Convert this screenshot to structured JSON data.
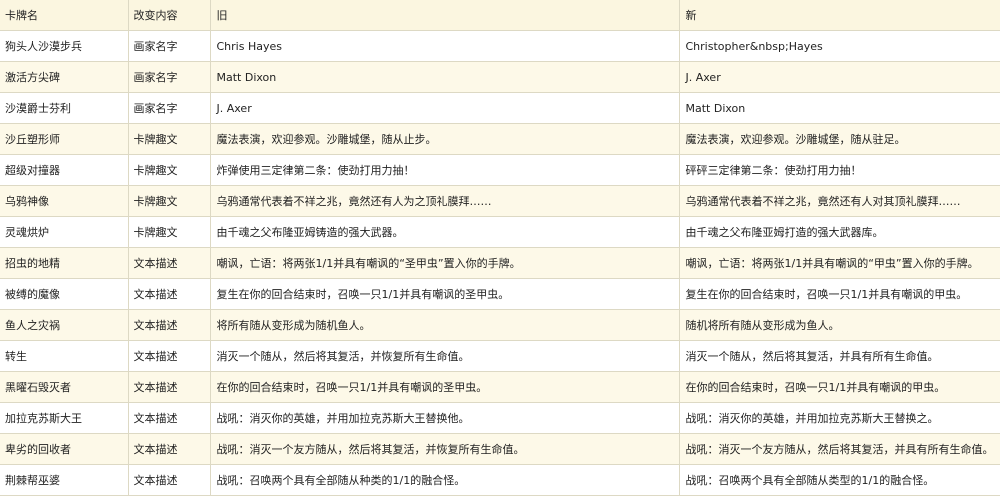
{
  "header": {
    "card_name": "卡牌名",
    "change_type": "改变内容",
    "old": "旧",
    "new": "新"
  },
  "rows": [
    {
      "card_name": "狗头人沙漠步兵",
      "change_type": "画家名字",
      "old": "Chris Hayes",
      "new": "Christopher&nbsp;Hayes"
    },
    {
      "card_name": "激活方尖碑",
      "change_type": "画家名字",
      "old": "Matt Dixon",
      "new": "J. Axer"
    },
    {
      "card_name": "沙漠爵士芬利",
      "change_type": "画家名字",
      "old": "J. Axer",
      "new": "Matt Dixon"
    },
    {
      "card_name": "沙丘塑形师",
      "change_type": "卡牌趣文",
      "old": "魔法表演，欢迎参观。沙雕城堡，随从止步。",
      "new": "魔法表演，欢迎参观。沙雕城堡，随从驻足。"
    },
    {
      "card_name": "超级对撞器",
      "change_type": "卡牌趣文",
      "old": "炸弹使用三定律第二条：使劲打用力抽！",
      "new": "砰砰三定律第二条：使劲打用力抽！"
    },
    {
      "card_name": "乌鸦神像",
      "change_type": "卡牌趣文",
      "old": "乌鸦通常代表着不祥之兆，竟然还有人为之顶礼膜拜……",
      "new": "乌鸦通常代表着不祥之兆，竟然还有人对其顶礼膜拜……"
    },
    {
      "card_name": "灵魂烘炉",
      "change_type": "卡牌趣文",
      "old": "由千魂之父布隆亚姆铸造的强大武器。",
      "new": "由千魂之父布隆亚姆打造的强大武器库。"
    },
    {
      "card_name": "招虫的地精",
      "change_type": "文本描述",
      "old": "嘲讽，亡语：将两张1/1并具有嘲讽的“圣甲虫”置入你的手牌。",
      "new": "嘲讽，亡语：将两张1/1并具有嘲讽的“甲虫”置入你的手牌。"
    },
    {
      "card_name": "被缚的魔像",
      "change_type": "文本描述",
      "old": "复生在你的回合结束时，召唤一只1/1并具有嘲讽的圣甲虫。",
      "new": "复生在你的回合结束时，召唤一只1/1并具有嘲讽的甲虫。"
    },
    {
      "card_name": "鱼人之灾祸",
      "change_type": "文本描述",
      "old": "将所有随从变形成为随机鱼人。",
      "new": "随机将所有随从变形成为鱼人。"
    },
    {
      "card_name": "转生",
      "change_type": "文本描述",
      "old": "消灭一个随从，然后将其复活，并恢复所有生命值。",
      "new": "消灭一个随从，然后将其复活，并具有所有生命值。"
    },
    {
      "card_name": "黑曜石毁灭者",
      "change_type": "文本描述",
      "old": "在你的回合结束时，召唤一只1/1并具有嘲讽的圣甲虫。",
      "new": "在你的回合结束时，召唤一只1/1并具有嘲讽的甲虫。"
    },
    {
      "card_name": "加拉克苏斯大王",
      "change_type": "文本描述",
      "old": "战吼：消灭你的英雄，并用加拉克苏斯大王替换他。",
      "new": "战吼：消灭你的英雄，并用加拉克苏斯大王替换之。"
    },
    {
      "card_name": "卑劣的回收者",
      "change_type": "文本描述",
      "old": "战吼：消灭一个友方随从，然后将其复活，并恢复所有生命值。",
      "new": "战吼：消灭一个友方随从，然后将其复活，并具有所有生命值。"
    },
    {
      "card_name": "荆棘帮巫婆",
      "change_type": "文本描述",
      "old": "战吼：召唤两个具有全部随从种类的1/1的融合怪。",
      "new": "战吼：召唤两个具有全部随从类型的1/1的融合怪。"
    }
  ]
}
